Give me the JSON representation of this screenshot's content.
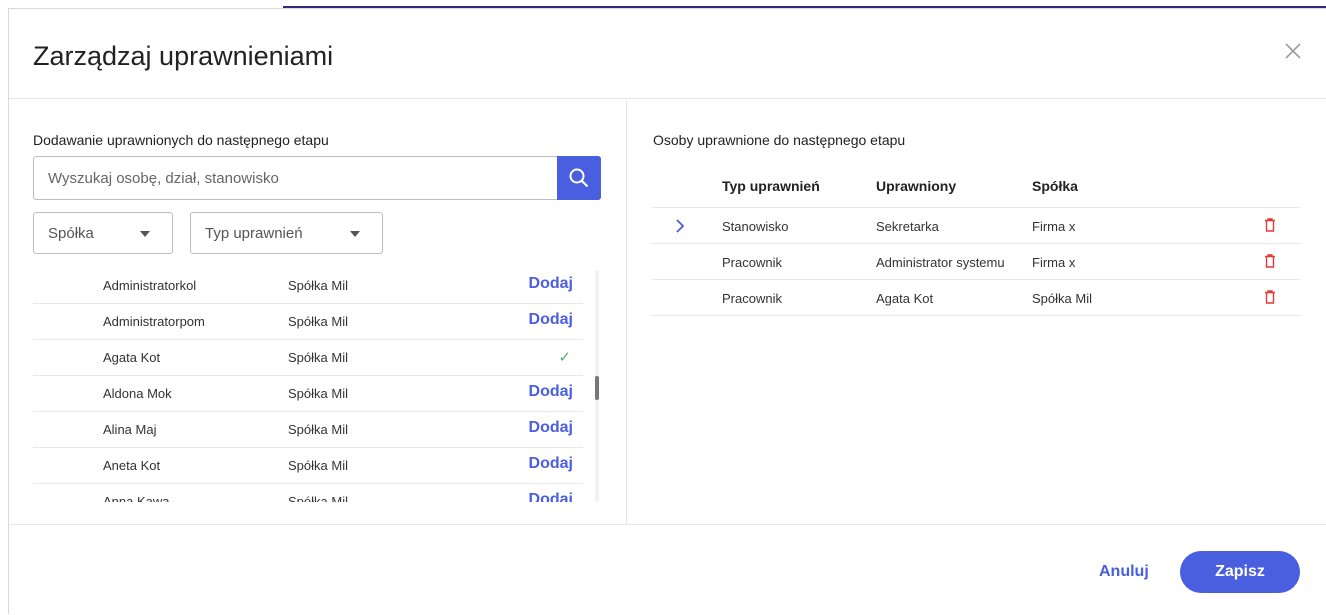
{
  "modal": {
    "title": "Zarządzaj uprawnieniami"
  },
  "left": {
    "title": "Dodawanie uprawnionych do następnego etapu",
    "search_placeholder": "Wyszukaj osobę, dział, stanowisko",
    "filters": {
      "company": "Spółka",
      "permission_type": "Typ uprawnień"
    },
    "list": [
      {
        "name": "Administratorkol",
        "company": "Spółka Mil",
        "action": "Dodaj",
        "added": false
      },
      {
        "name": "Administratorpom",
        "company": "Spółka Mil",
        "action": "Dodaj",
        "added": false
      },
      {
        "name": "Agata Kot",
        "company": "Spółka Mil",
        "action": "",
        "added": true
      },
      {
        "name": "Aldona Mok",
        "company": "Spółka Mil",
        "action": "Dodaj",
        "added": false
      },
      {
        "name": "Alina Maj",
        "company": "Spółka Mil",
        "action": "Dodaj",
        "added": false
      },
      {
        "name": "Aneta Kot",
        "company": "Spółka Mil",
        "action": "Dodaj",
        "added": false
      },
      {
        "name": "Anna Kawa",
        "company": "Spółka Mil",
        "action": "Dodaj",
        "added": false
      }
    ],
    "check_glyph": "✓"
  },
  "right": {
    "title": "Osoby uprawnione do następnego etapu",
    "columns": {
      "type": "Typ uprawnień",
      "person": "Uprawniony",
      "company": "Spółka"
    },
    "rows": [
      {
        "type": "Stanowisko",
        "person": "Sekretarka",
        "company": "Firma x",
        "expandable": true
      },
      {
        "type": "Pracownik",
        "person": "Administrator systemu",
        "company": "Firma x",
        "expandable": false
      },
      {
        "type": "Pracownik",
        "person": "Agata Kot",
        "company": "Spółka Mil",
        "expandable": false
      }
    ]
  },
  "footer": {
    "cancel": "Anuluj",
    "save": "Zapisz"
  },
  "colors": {
    "accent": "#4a5ee0",
    "delete": "#e53935",
    "check": "#4caf70"
  },
  "icons": {
    "close": "close-icon",
    "search": "search-icon",
    "delete": "trash-icon",
    "expand": "chevron-right-icon",
    "dropdown": "caret-down-icon"
  }
}
